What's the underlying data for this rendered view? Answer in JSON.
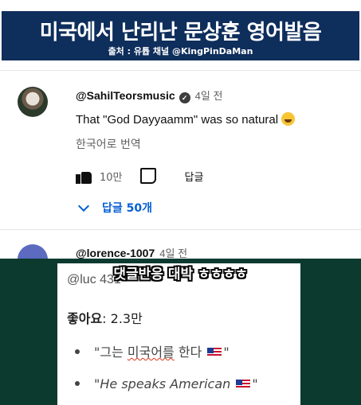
{
  "banner": {
    "title": "미국에서 난리난 문상훈 영어발음",
    "credit": "출처 : 유튭 채널 @KingPinDaMan"
  },
  "comment1": {
    "handle": "@SahilTeorsmusic",
    "time": "4일 전",
    "text": "That \"God Dayyaamm\" was so natural",
    "translate": "한국어로 번역",
    "likes": "10만",
    "reply_label": "답글",
    "replies_label": "답글 50개"
  },
  "comment2": {
    "handle": "@lorence-1007",
    "time": "4일 전"
  },
  "caption": "댓글반응 대박 ㅎㅎㅎㅎ",
  "inset": {
    "handle": "@luc 431",
    "likes_label": "좋아요",
    "likes_value": ": 2.3만",
    "bullet1_prefix": "\"그는 ",
    "bullet1_squiggle": "미국어를",
    "bullet1_suffix": " 한다",
    "bullet2": "\"He speaks American",
    "quote_close": "\""
  },
  "colors": {
    "banner": "#0e2e5c",
    "overlay": "#0d3a2f",
    "link": "#065fd4"
  }
}
